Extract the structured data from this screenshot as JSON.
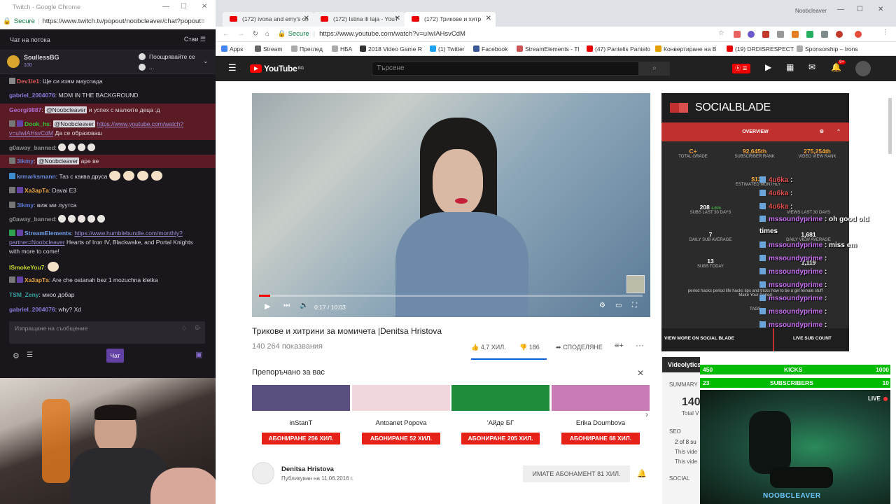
{
  "chat_window": {
    "title": "Twitch - Google Chrome",
    "secure": "Secure",
    "url": "https://www.twitch.tv/popout/noobcleaver/chat?popout=",
    "header": "Чат на потока",
    "header_right": "Стаи",
    "pinned_user": "SoullessBG",
    "pinned_points": "100",
    "pinned_text": "Поощрявайте се",
    "pinned_more": "...",
    "messages": [
      {
        "user": "Dev1le1",
        "text": "Ще си изям мауспада",
        "color": "#e05b5b"
      },
      {
        "user": "gabriel_2004076",
        "text": "MOM IN THE BACKGROUND",
        "color": "#8a7bd8"
      },
      {
        "user": "Georgi9887",
        "mention": "@Noobcleaver",
        "text": "и успех с малките деца :д",
        "color": "#b06dd0"
      },
      {
        "user": "Dook_hs",
        "mention": "@Noobcleaver",
        "link": "https://www.youtube.com/watch?v=uIwIAHsvCdM",
        "text": "Да се образоваш",
        "color": "#33c233"
      },
      {
        "user": "g0away_banned",
        "text": "",
        "color": "#8a8a8a"
      },
      {
        "user": "3ikmy",
        "mention": "@Noobcleaver",
        "text": "аре ве",
        "color": "#5b7bd5"
      },
      {
        "user": "krmarksmann",
        "text": "Таз с каква друса",
        "color": "#6b8bdc"
      },
      {
        "user": "Ха3арТа",
        "text": "Davai E3",
        "color": "#e6a440"
      },
      {
        "user": "3ikmy",
        "text": "вижмилуутса",
        "display": "виж ми луутса",
        "color": "#5b7bd5"
      },
      {
        "user": "g0away_banned",
        "text": "",
        "color": "#8a8a8a"
      },
      {
        "user": "StreamElements",
        "link": "https://www.humblebundle.com/monthly?partner=Noobcleaver",
        "text": "Hearts of Iron IV, Blackwake, and Portal Knights with more to come!",
        "color": "#6f9ee8"
      },
      {
        "user": "ISmokeYou7",
        "text": "",
        "color": "#c8d830"
      },
      {
        "user": "Ха3арТа",
        "text": "Are che ostanah bez 1 mozuchna kletka",
        "color": "#e6a440"
      },
      {
        "user": "TSM_Zeny",
        "text": "мноо добар",
        "color": "#35a39e"
      },
      {
        "user": "gabriel_2004076",
        "text": "why? Xd",
        "color": "#8a7bd8"
      }
    ],
    "input_placeholder": "Изпращане на съобщение",
    "send_label": "Чат"
  },
  "browser": {
    "tabs": [
      {
        "label": "(172) ivona and emy's ch"
      },
      {
        "label": "(172) Istina ili laja - YouT"
      },
      {
        "label": "(172) Трикове и хитр"
      }
    ],
    "profile": "Noobcleaver",
    "secure": "Secure",
    "url": "https://www.youtube.com/watch?v=uIwIAHsvCdM",
    "bookmarks": [
      "Apps",
      "Stream",
      "Преглед",
      "НБА",
      "2018 Video Game R",
      "(1) Twitter",
      "Facebook",
      "StreamElements - Tl",
      "(47) Pantelis Pantelo",
      "Конвертиране на В",
      "(19) DRDISRESPECT",
      "Sponsorship – Irons"
    ]
  },
  "youtube": {
    "logo": "YouTube",
    "region": "BG",
    "search_placeholder": "Търсене",
    "notif_count": "9+",
    "time": "0:17 / 10:03",
    "video_title": "Трикове и хитрини за момичета |Denitsa Hristova",
    "views": "140 264 показвания",
    "likes": "4,7 ХИЛ.",
    "dislikes": "186",
    "share": "СПОДЕЛЯНЕ",
    "recommended_header": "Препоръчано за вас",
    "recommended": [
      {
        "name": "inStanT",
        "subscribe": "АБОНИРАНЕ  256 ХИЛ.",
        "color": "#5b4f80"
      },
      {
        "name": "Antoanet Popova",
        "subscribe": "АБОНИРАНЕ  52 ХИЛ.",
        "color": "#f1d6dc"
      },
      {
        "name": "'Айде БГ",
        "subscribe": "АБОНИРАНЕ  205 ХИЛ.",
        "color": "#1e8c3a"
      },
      {
        "name": "Erika Doumbova",
        "subscribe": "АБОНИРАНЕ  68 ХИЛ.",
        "color": "#c97bb6"
      }
    ],
    "channel_name": "Denitsa Hristova",
    "published": "Публикуван на 11.06.2016 г.",
    "subscribed_label": "ИМАТЕ АБОНАМЕНТ  81 ХИЛ."
  },
  "socialblade": {
    "title": "SOCIALBLADE",
    "tab": "OVERVIEW",
    "grade": "C+",
    "grade_label": "TOTAL GRADE",
    "sub_rank": "92,645th",
    "sub_rank_label": "SUBSCRIBER RANK",
    "view_rank": "275,254th",
    "view_rank_label": "VIDEO VIEW RANK",
    "est_monthly": "$13 -",
    "est_label": "ESTIMATED MONTHLY",
    "subs30": "208",
    "subs30_pct": "4.05%",
    "subs30_label": "SUBS LAST 30 DAYS",
    "views30_label": "VIEWS LAST 30 DAYS",
    "daily_avg": "7",
    "daily_avg_label": "DAILY SUB AVERAGE",
    "daily_view": "1,681",
    "daily_view_label": "DAILY VIEW AVERAGE",
    "subs_today": "13",
    "subs_today_label": "SUBS TODAY",
    "views_today": "1,119",
    "tags": "period hacks   period life hacks   tips and tricks   how to be a girl   female stuff",
    "tags2": "Make Your Period",
    "tags_label": "TAGS",
    "more": "VIEW MORE ON SOCIAL BLADE",
    "live": "LIVE SUB COUNT"
  },
  "videolytics": {
    "title": "Videolytics",
    "summary": "SUMMARY",
    "total_num": "140",
    "total_label": "Total V",
    "seo": "SEO",
    "seo1": "2 of 8 su",
    "seo2": "This vide",
    "seo3": "This vide",
    "social": "SOCIAL"
  },
  "overlay_chat": [
    {
      "user": "4u6ka",
      "text": ":",
      "cls": "n2"
    },
    {
      "user": "4u6ka",
      "text": ":",
      "cls": "n2"
    },
    {
      "user": "4u6ka",
      "text": ":",
      "cls": "n2"
    },
    {
      "user": "mssoundyprime",
      "text": ": oh good old times",
      "cls": "n"
    },
    {
      "user": "mssoundyprime",
      "text": ": miss em",
      "cls": "n"
    },
    {
      "user": "mssoundyprime",
      "text": ":",
      "cls": "n"
    },
    {
      "user": "mssoundyprime",
      "text": ":",
      "cls": "n"
    },
    {
      "user": "mssoundyprime",
      "text": ":",
      "cls": "n"
    },
    {
      "user": "mssoundyprime",
      "text": ":",
      "cls": "n"
    },
    {
      "user": "mssoundyprime",
      "text": ":",
      "cls": "n"
    },
    {
      "user": "mssoundyprime",
      "text": ":",
      "cls": "n"
    }
  ],
  "counters": {
    "kicks_current": "450",
    "kicks_label": "KICKS",
    "kicks_goal": "1000",
    "subs_current": "23",
    "subs_label": "SUBSCRIBERS",
    "subs_goal": "10"
  },
  "cam2": {
    "live": "LIVE",
    "name": "NOOBCLEAVER"
  }
}
